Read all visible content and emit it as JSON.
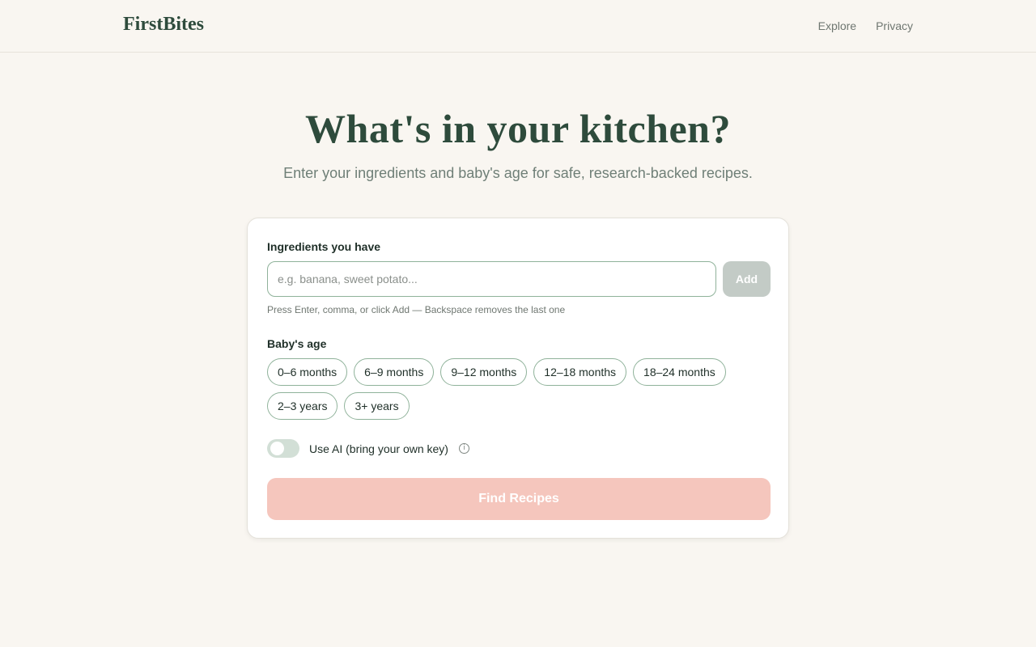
{
  "header": {
    "brand": "FirstBites",
    "nav": [
      {
        "label": "Explore"
      },
      {
        "label": "Privacy"
      }
    ]
  },
  "hero": {
    "title": "What's in your kitchen?",
    "subtitle": "Enter your ingredients and baby's age for safe, research-backed recipes."
  },
  "form": {
    "ingredients": {
      "label": "Ingredients you have",
      "placeholder": "e.g. banana, sweet potato...",
      "value": "",
      "add_label": "Add",
      "hint": "Press Enter, comma, or click Add — Backspace removes the last one"
    },
    "age": {
      "label": "Baby's age",
      "options": [
        {
          "label": "0–6 months"
        },
        {
          "label": "6–9 months"
        },
        {
          "label": "9–12 months"
        },
        {
          "label": "12–18 months"
        },
        {
          "label": "18–24 months"
        },
        {
          "label": "2–3 years"
        },
        {
          "label": "3+ years"
        }
      ]
    },
    "ai_toggle": {
      "label": "Use AI (bring your own key)",
      "on": false,
      "info_icon": "info-icon"
    },
    "submit_label": "Find Recipes"
  },
  "colors": {
    "background": "#f9f6f1",
    "brand": "#2e4b3c",
    "chip_border": "#8fb29a",
    "submit_disabled": "#f5c6bd",
    "add_disabled": "#c3cbc6"
  }
}
